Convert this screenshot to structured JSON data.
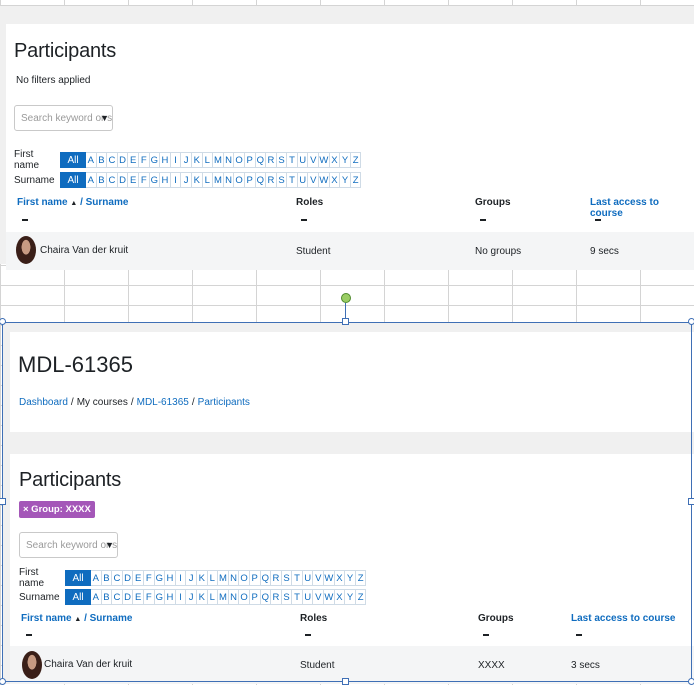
{
  "top": {
    "heading": "Participants",
    "filters_text": "No filters applied",
    "search_placeholder": "Search keyword or select filter",
    "first_name_label": "First name",
    "surname_label": "Surname",
    "all_label": "All",
    "letters": [
      "A",
      "B",
      "C",
      "D",
      "E",
      "F",
      "G",
      "H",
      "I",
      "J",
      "K",
      "L",
      "M",
      "N",
      "O",
      "P",
      "Q",
      "R",
      "S",
      "T",
      "U",
      "V",
      "W",
      "X",
      "Y",
      "Z"
    ],
    "columns": {
      "first_name": "First name",
      "sort_arrow": "▲",
      "surname": "/ Surname",
      "roles": "Roles",
      "groups": "Groups",
      "last_access": "Last access to course"
    },
    "row": {
      "name": "Chaira Van der kruit",
      "role": "Student",
      "groups": "No groups",
      "last_access": "9 secs"
    }
  },
  "bottom": {
    "course_title": "MDL-61365",
    "breadcrumb": [
      "Dashboard",
      "My courses",
      "MDL-61365",
      "Participants"
    ],
    "breadcrumb_sep": "/",
    "heading": "Participants",
    "filter_badge": "× Group: XXXX",
    "search_placeholder": "Search keyword or select filter",
    "first_name_label": "First name",
    "surname_label": "Surname",
    "all_label": "All",
    "columns": {
      "first_name": "First name",
      "sort_arrow": "▲",
      "surname": "/ Surname",
      "roles": "Roles",
      "groups": "Groups",
      "last_access": "Last access to course"
    },
    "row": {
      "name": "Chaira Van der kruit",
      "role": "Student",
      "groups": "XXXX",
      "last_access": "3 secs"
    }
  },
  "colors": {
    "link": "#0f6cbf",
    "badge": "#a457b8",
    "selection": "#3f6fb5",
    "rotate_handle": "#9acd64"
  }
}
